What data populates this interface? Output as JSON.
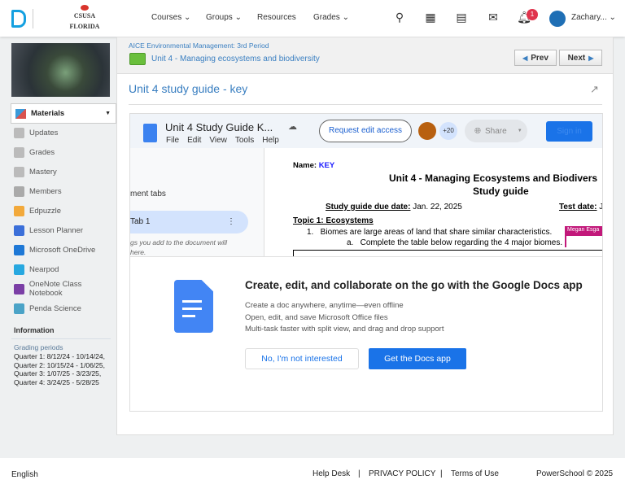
{
  "header": {
    "logo": "CSUSA FLORIDA",
    "nav": [
      "Courses",
      "Groups",
      "Resources",
      "Grades"
    ],
    "notifications_count": "1",
    "user": "Zachary..."
  },
  "breadcrumb": {
    "course": "AICE Environmental Management: 3rd Period",
    "folder": "Unit 4 - Managing ecosystems and biodiversity"
  },
  "pager": {
    "prev": "Prev",
    "next": "Next"
  },
  "page_title": "Unit 4 study guide - key",
  "sidebar": {
    "items": [
      {
        "label": "Materials",
        "icon": "materials-icon",
        "color": "#d9534f"
      },
      {
        "label": "Updates",
        "icon": "updates-icon",
        "color": "#bbb"
      },
      {
        "label": "Grades",
        "icon": "grades-icon",
        "color": "#bbb"
      },
      {
        "label": "Mastery",
        "icon": "mastery-icon",
        "color": "#bbb"
      },
      {
        "label": "Members",
        "icon": "members-icon",
        "color": "#aaa"
      },
      {
        "label": "Edpuzzle",
        "icon": "edpuzzle-icon",
        "color": "#f2a93b"
      },
      {
        "label": "Lesson Planner",
        "icon": "lesson-planner-icon",
        "color": "#3b6fd9"
      },
      {
        "label": "Microsoft OneDrive",
        "icon": "onedrive-icon",
        "color": "#1e78d6"
      },
      {
        "label": "Nearpod",
        "icon": "nearpod-icon",
        "color": "#27a8e0"
      },
      {
        "label": "OneNote Class Notebook",
        "icon": "onenote-icon",
        "color": "#7b3fa6"
      },
      {
        "label": "Penda Science",
        "icon": "penda-icon",
        "color": "#4ba3c7"
      }
    ],
    "info_title": "Information",
    "grading_label": "Grading periods",
    "quarters": [
      "Quarter 1: 8/12/24 - 10/14/24,",
      "Quarter 2: 10/15/24 - 1/06/25,",
      "Quarter 3: 1/07/25 - 3/23/25,",
      "Quarter 4: 3/24/25 - 5/28/25"
    ]
  },
  "docs": {
    "title": "Unit 4 Study Guide K...",
    "menu": [
      "File",
      "Edit",
      "View",
      "Tools",
      "Help"
    ],
    "request_access": "Request edit access",
    "collab_count": "+20",
    "share": "Share",
    "sign_in": "Sign in",
    "tabs_heading": "ment tabs",
    "tab1": "Tab 1",
    "tabs_hint": "gs you add to the document will here.",
    "name_label": "Name:",
    "name_value": "KEY",
    "doc_title": "Unit 4 - Managing Ecosystems and Biodivers",
    "doc_subtitle": "Study guide",
    "due_label": "Study guide due date:",
    "due_value": "Jan. 22, 2025",
    "test_label": "Test date:",
    "test_value": "J",
    "topic": "Topic 1: Ecosystems",
    "item1": "1.   Biomes are large areas of land that share similar characteristics.",
    "item1a": "a.   Complete the table below regarding the 4 major biomes.",
    "comment_user": "Megan Esga",
    "promo_title": "Create, edit, and collaborate on the go with the Google Docs app",
    "promo_lines": [
      "Create a doc anywhere, anytime—even offline",
      "Open, edit, and save Microsoft Office files",
      "Multi-task faster with split view, and drag and drop support"
    ],
    "decline": "No, I'm not interested",
    "accept": "Get the Docs app"
  },
  "footer": {
    "language": "English",
    "links": [
      "Help Desk",
      "PRIVACY POLICY",
      "Terms of Use"
    ],
    "copyright": "PowerSchool © 2025"
  },
  "colors": {
    "link": "#3a7fc1",
    "docs_blue": "#1a73e8",
    "folder": "#6abf3c",
    "badge": "#e0344d"
  }
}
